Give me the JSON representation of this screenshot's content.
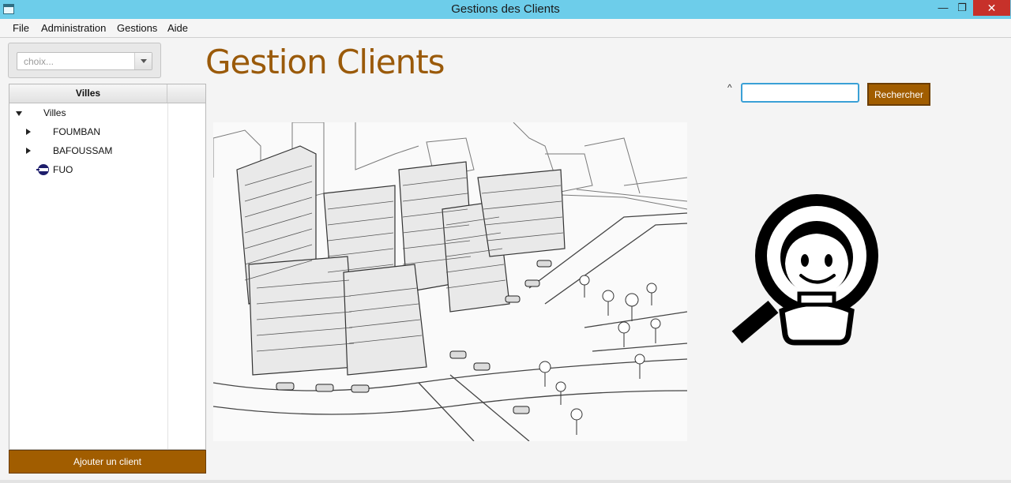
{
  "window": {
    "title": "Gestions des Clients",
    "minimize_glyph": "—",
    "maximize_glyph": "❐",
    "close_glyph": "✕",
    "icon": "window-app-icon"
  },
  "menubar": {
    "items": [
      "File",
      "Administration",
      "Gestions",
      "Aide"
    ]
  },
  "combo": {
    "placeholder": "choix..."
  },
  "tree": {
    "column_header": "Villes",
    "root": {
      "label": "Villes",
      "expanded": true
    },
    "children": [
      {
        "label": "FOUMBAN",
        "expanded": false
      },
      {
        "label": "BAFOUSSAM",
        "expanded": false
      },
      {
        "label": "FUO",
        "leaf": true
      }
    ]
  },
  "add_client_button": {
    "label": "Ajouter un client"
  },
  "page": {
    "heading": "Gestion Clients"
  },
  "search": {
    "caret": "^",
    "value": "",
    "placeholder": "",
    "button_label": "Rechercher"
  },
  "colors": {
    "titlebar": "#6dcdea",
    "accent_brown": "#a15d00",
    "heading": "#9a5a0a",
    "focus_blue": "#3aa0d6"
  }
}
